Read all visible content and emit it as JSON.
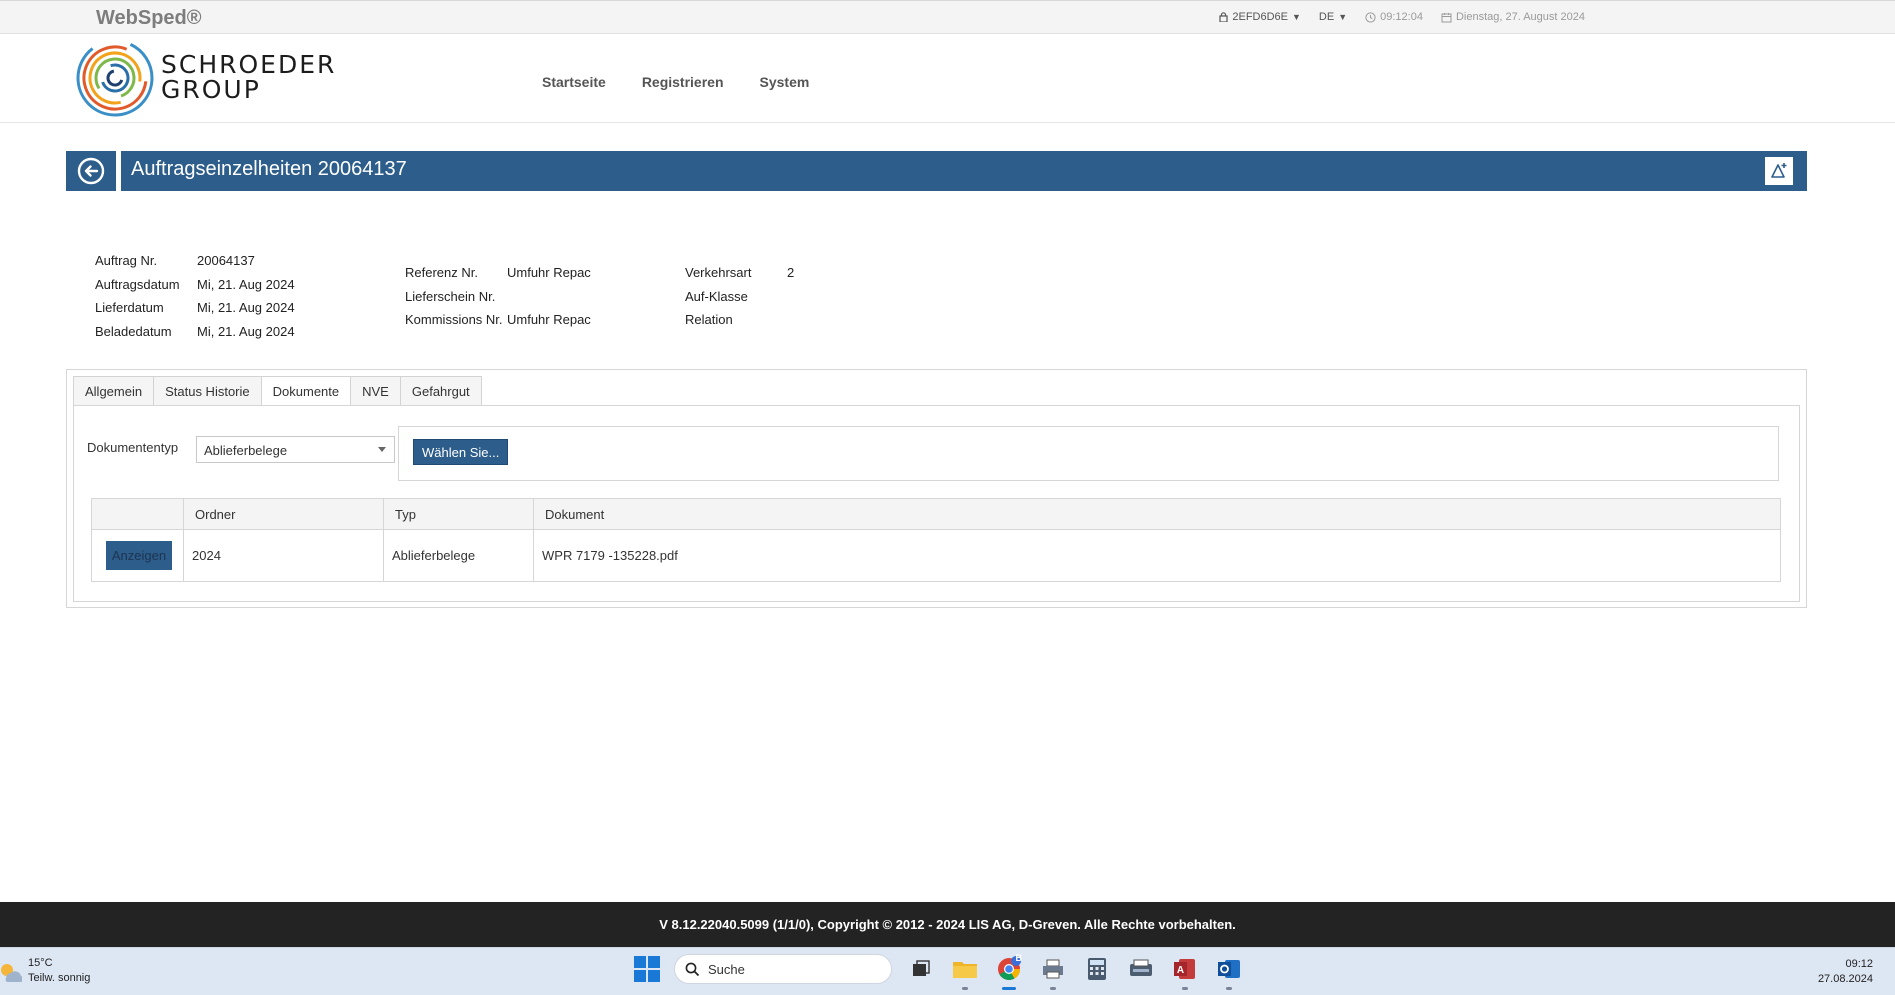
{
  "app": {
    "name": "WebSped®"
  },
  "topbar": {
    "session_id": "2EFD6D6E",
    "language": "DE",
    "time": "09:12:04",
    "date": "Dienstag, 27. August 2024"
  },
  "logo": {
    "line1": "SCHROEDER",
    "line2": "GROUP"
  },
  "nav": {
    "home": "Startseite",
    "register": "Registrieren",
    "system": "System"
  },
  "page": {
    "title": "Auftragseinzelheiten 20064137"
  },
  "order": {
    "left": [
      {
        "label": "Auftrag Nr.",
        "value": "20064137"
      },
      {
        "label": "Auftragsdatum",
        "value": "Mi, 21. Aug 2024"
      },
      {
        "label": "Lieferdatum",
        "value": "Mi, 21. Aug 2024"
      },
      {
        "label": "Beladedatum",
        "value": "Mi, 21. Aug 2024"
      }
    ],
    "middle": [
      {
        "label": "Referenz Nr.",
        "value": "Umfuhr Repac"
      },
      {
        "label": "Lieferschein Nr.",
        "value": ""
      },
      {
        "label": "Kommissions Nr.",
        "value": "Umfuhr Repac"
      }
    ],
    "right": [
      {
        "label": "Verkehrsart",
        "value": "2"
      },
      {
        "label": "Auf-Klasse",
        "value": ""
      },
      {
        "label": "Relation",
        "value": ""
      }
    ]
  },
  "tabs": [
    "Allgemein",
    "Status Historie",
    "Dokumente",
    "NVE",
    "Gefahrgut"
  ],
  "documents": {
    "type_label": "Dokumententyp",
    "type_value": "Ablieferbelege",
    "choose_button": "Wählen Sie...",
    "columns": [
      "",
      "Ordner",
      "Typ",
      "Dokument"
    ],
    "rows": [
      {
        "action": "Anzeigen",
        "folder": "2024",
        "type": "Ablieferbelege",
        "document": "WPR 7179 -135228.pdf"
      }
    ]
  },
  "footer": {
    "text": "V 8.12.22040.5099 (1/1/0), Copyright © 2012 - 2024 LIS AG, D-Greven. Alle Rechte vorbehalten."
  },
  "taskbar": {
    "weather_temp": "15°C",
    "weather_desc": "Teilw. sonnig",
    "search_placeholder": "Suche",
    "chrome_badge": "B",
    "clock_time": "09:12",
    "clock_date": "27.08.2024"
  },
  "colors": {
    "primary": "#2c5d8b",
    "footer_bg": "#232323",
    "taskbar_bg": "#dde6f3"
  }
}
